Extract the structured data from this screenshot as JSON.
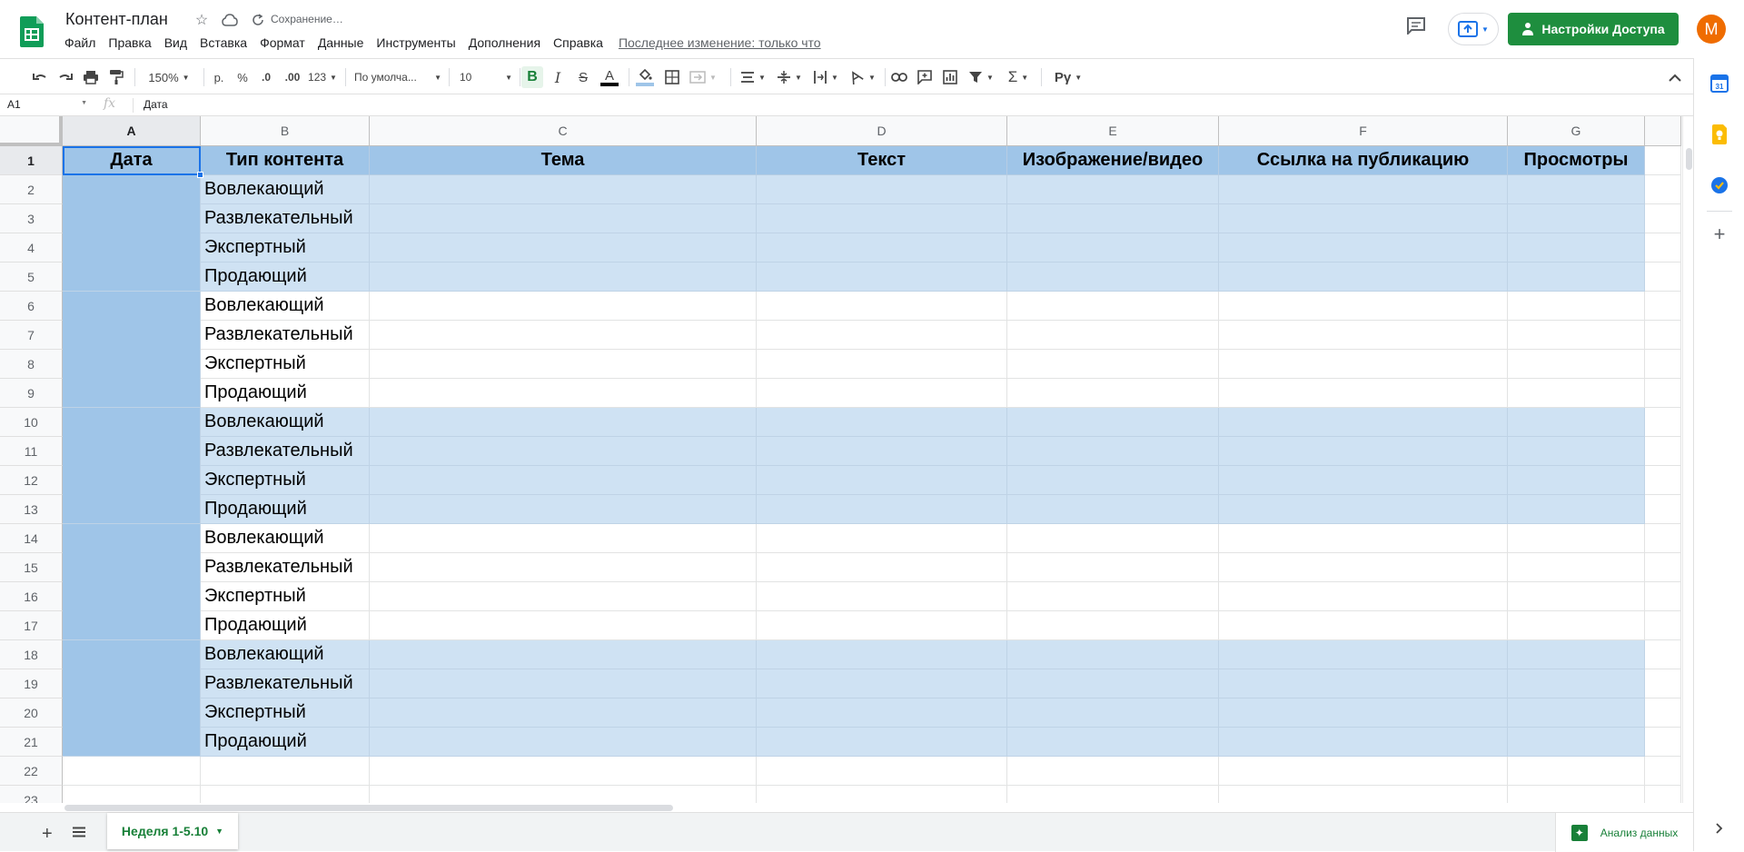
{
  "document": {
    "title": "Контент-план",
    "saving_status": "Сохранение…",
    "last_edit": "Последнее изменение: только что"
  },
  "menu": [
    "Файл",
    "Правка",
    "Вид",
    "Вставка",
    "Формат",
    "Данные",
    "Инструменты",
    "Дополнения",
    "Справка"
  ],
  "header": {
    "share_label": "Настройки Доступа",
    "avatar_letter": "M"
  },
  "toolbar": {
    "zoom": "150%",
    "currency": "р.",
    "percent": "%",
    "decrease_decimals": ".0",
    "increase_decimals": ".00",
    "more_formats": "123",
    "font": "По умолча...",
    "font_size": "10"
  },
  "formula_bar": {
    "cell_ref": "A1",
    "fx": "fx",
    "value": "Дата"
  },
  "columns": [
    "A",
    "B",
    "C",
    "D",
    "E",
    "F",
    "G"
  ],
  "rows": [
    "1",
    "2",
    "3",
    "4",
    "5",
    "6",
    "7",
    "8",
    "9",
    "10",
    "11",
    "12",
    "13",
    "14",
    "15",
    "16",
    "17",
    "18",
    "19",
    "20",
    "21",
    "22",
    "23"
  ],
  "table_header": [
    "Дата",
    "Тип контента",
    "Тема",
    "Текст",
    "Изображение/видео",
    "Ссылка на публикацию",
    "Просмотры"
  ],
  "content_types": [
    "Вовлекающий",
    "Развлекательный",
    "Экспертный",
    "Продающий",
    "Вовлекающий",
    "Развлекательный",
    "Экспертный",
    "Продающий",
    "Вовлекающий",
    "Развлекательный",
    "Экспертный",
    "Продающий",
    "Вовлекающий",
    "Развлекательный",
    "Экспертный",
    "Продающий",
    "Вовлекающий",
    "Развлекательный",
    "Экспертный",
    "Продающий"
  ],
  "sheet_tab": "Неделя 1-5.10",
  "explore_label": "Анализ данных",
  "colors": {
    "header_blue": "#9fc5e8",
    "band_light_blue": "#cfe2f3",
    "share_green": "#1e8e3e",
    "selection_blue": "#1a73e8",
    "avatar_orange": "#ef6c00"
  }
}
